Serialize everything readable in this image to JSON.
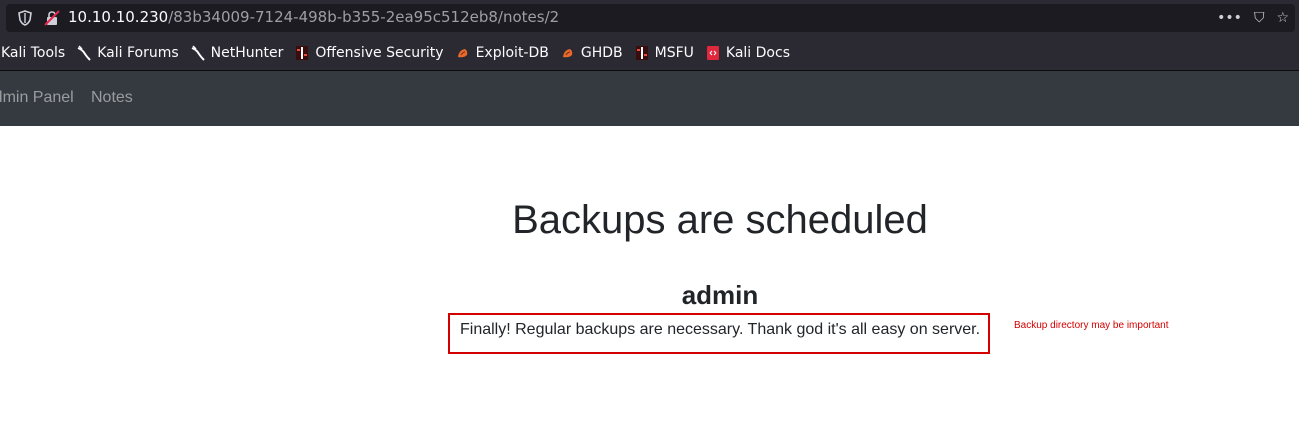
{
  "browser": {
    "url_host": "10.10.10.230",
    "url_path": "/83b34009-7124-498b-b355-2ea95c512eb8/notes/2",
    "actions": {
      "more": "•••",
      "pocket": "⛉",
      "bookmark": "☆"
    }
  },
  "bookmarks": [
    {
      "label": "Kali Tools",
      "icon": "kali-icon"
    },
    {
      "label": "Kali Forums",
      "icon": "kali-dragon-icon"
    },
    {
      "label": "NetHunter",
      "icon": "kali-dragon-icon"
    },
    {
      "label": "Offensive Security",
      "icon": "offsec-icon"
    },
    {
      "label": "Exploit-DB",
      "icon": "exploitdb-icon"
    },
    {
      "label": "GHDB",
      "icon": "exploitdb-icon"
    },
    {
      "label": "MSFU",
      "icon": "offsec-icon"
    },
    {
      "label": "Kali Docs",
      "icon": "kali-docs-icon"
    }
  ],
  "navbar": {
    "admin_panel": "Admin Panel",
    "notes": "Notes"
  },
  "note": {
    "title": "Backups are scheduled",
    "author": "admin",
    "body": "Finally! Regular backups are necessary. Thank god it's all easy on server.",
    "annotation": "Backup directory may be important"
  },
  "colors": {
    "navbar_bg": "#343a40",
    "annotation_red": "#d40000",
    "browser_chrome": "#2b2a33"
  }
}
